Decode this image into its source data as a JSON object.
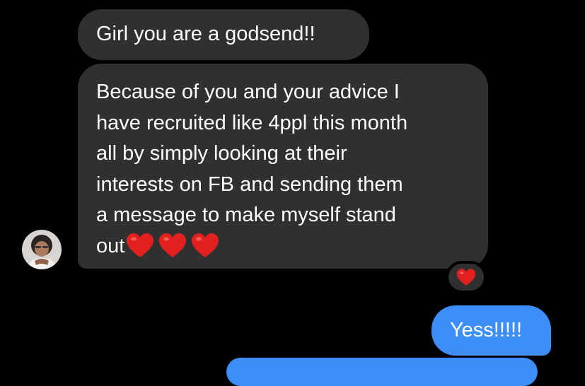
{
  "conversation": {
    "messages": [
      {
        "direction": "incoming",
        "text": "Girl you are a godsend!!"
      },
      {
        "direction": "incoming",
        "text_lines": [
          "Because of you and your advice I",
          "have recruited like 4ppl this month",
          "all by simply looking at their",
          "interests on FB and sending them",
          "a message to make myself stand",
          "out"
        ],
        "trailing_emoji": [
          "red-heart",
          "red-heart",
          "red-heart"
        ],
        "reaction": "red-heart"
      },
      {
        "direction": "outgoing",
        "text": "Yess!!!!!"
      }
    ]
  },
  "colors": {
    "background": "#000000",
    "incoming_bubble": "#303030",
    "outgoing_bubble": "#3e8ef7",
    "text": "#ffffff",
    "heart": "#e1201f"
  }
}
